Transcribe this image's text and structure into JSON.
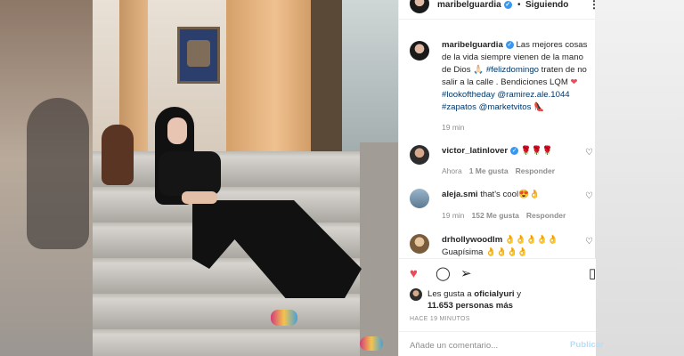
{
  "post": {
    "username": "maribelguardia",
    "follow_status": "Siguiendo",
    "more_icon": "⋮"
  },
  "caption": {
    "username": "maribelguardia",
    "text_1": " Las mejores cosas de la vida siempre vienen de la mano de Dios 🙏🏻 ",
    "hashtag_1": "#felizdomingo",
    "text_2": " traten de no salir a la calle . Bendiciones LQM ",
    "heart": "❤",
    "hashtag_2": "#lookoftheday",
    "mention_1": "@ramirez.ale.1044",
    "hashtag_3": "#zapatos",
    "mention_2": "@marketvitos",
    "shoe": "👠",
    "time": "19 min"
  },
  "comments": [
    {
      "username": "victor_latinlover",
      "text": "🌹🌹🌹",
      "time": "Ahora",
      "likes": "1 Me gusta",
      "reply": "Responder"
    },
    {
      "username": "aleja.smi",
      "text": "that's cool😍👌",
      "time": "19 min",
      "likes": "152 Me gusta",
      "reply": "Responder"
    },
    {
      "username": "drhollywoodlm",
      "text": "👌👌👌👌👌",
      "text_2": "Guapísima 👌👌👌👌"
    }
  ],
  "actions": {
    "liked_by_prefix": "Les gusta a ",
    "liked_by_user": "oficialyuri",
    "liked_by_suffix": " y",
    "liked_count": "11.653 personas más",
    "time_ago": "HACE 19 MINUTOS"
  },
  "compose": {
    "placeholder": "Añade un comentario...",
    "post_label": "Publicar"
  },
  "colors": {
    "link": "#00376b",
    "like_red": "#ed4956",
    "verified": "#3897f0",
    "muted": "#8e8e8e"
  }
}
